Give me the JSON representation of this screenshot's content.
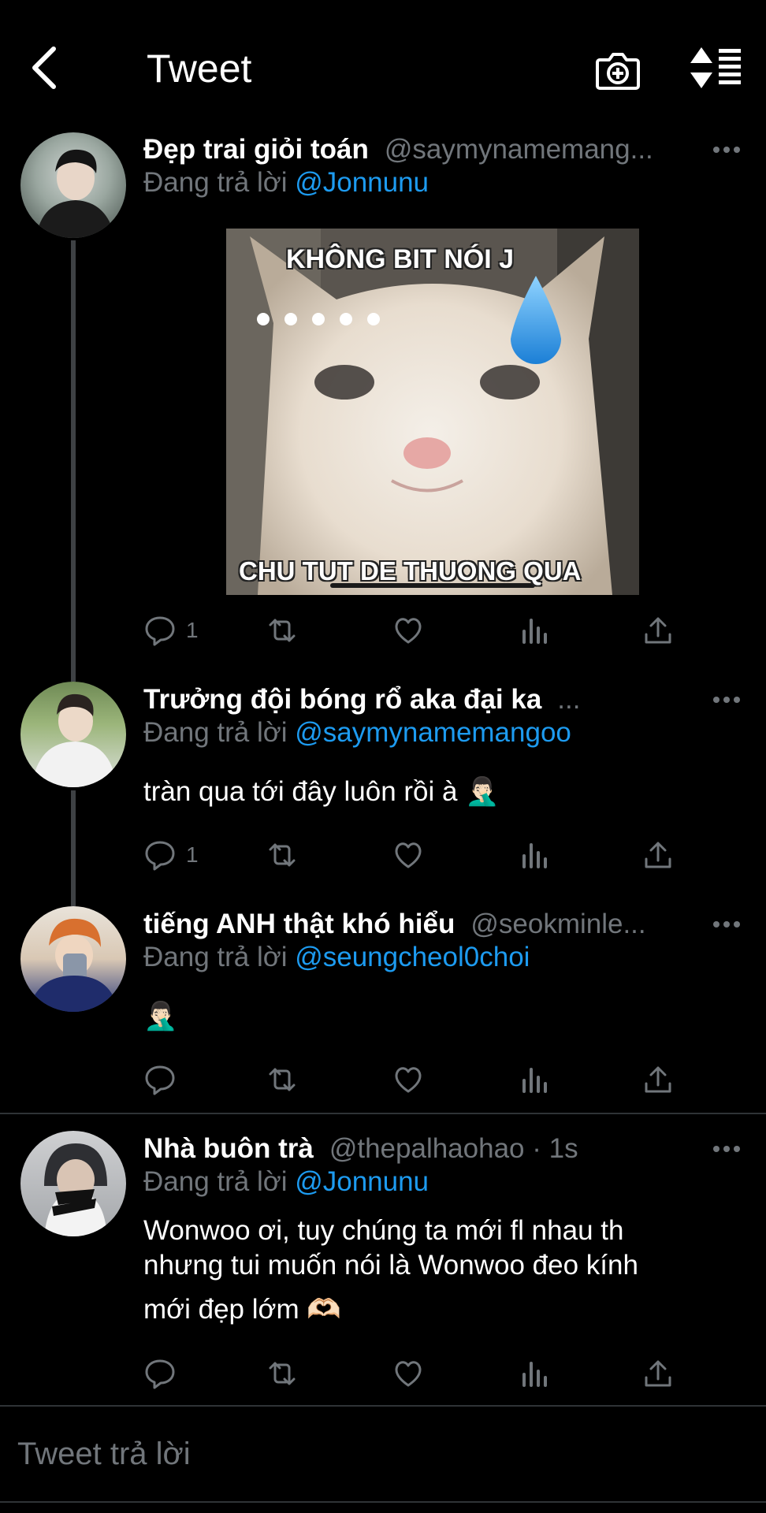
{
  "header": {
    "title": "Tweet",
    "back_icon": "chevron-left-icon",
    "camera_icon": "camera-plus-icon",
    "sort_icon": "sort-icon"
  },
  "tweets": [
    {
      "name": "Đẹp trai giỏi toán",
      "handle": "@saymynamemang...",
      "reply_prefix": "Đang trả lời",
      "reply_to": "@Jonnunu",
      "text": "",
      "media": {
        "top_text": "KHÔNG BIT NÓI J",
        "bottom_text": "CHU TUT DE THUONG QUA"
      },
      "reply_count": "1"
    },
    {
      "name": "Trưởng đội bóng rổ aka đại ka",
      "handle": "...",
      "reply_prefix": "Đang trả lời",
      "reply_to": "@saymynamemangoo",
      "text": "tràn qua tới đây luôn rồi à 🤦🏻‍♂️",
      "reply_count": "1"
    },
    {
      "name": "tiếng ANH thật khó hiểu",
      "handle": "@seokminle...",
      "reply_prefix": "Đang trả lời",
      "reply_to": "@seungcheol0choi",
      "text": "🤦🏻‍♂️",
      "reply_count": ""
    },
    {
      "name": "Nhà buôn trà",
      "handle": "@thepalhaohao · 1s",
      "reply_prefix": "Đang trả lời",
      "reply_to": "@Jonnunu",
      "text_line1": "Wonwoo ơi, tuy chúng ta mới fl nhau th",
      "text_line2": "nhưng tui muốn nói là  Wonwoo đeo kính",
      "text_line3": "mới đẹp lớm 🫶🏻",
      "reply_count": ""
    }
  ],
  "composer": {
    "placeholder": "Tweet trả lời"
  },
  "colors": {
    "background": "#000000",
    "accent": "#1d9bf0",
    "muted": "#71767b",
    "text": "#e7e9ea"
  }
}
